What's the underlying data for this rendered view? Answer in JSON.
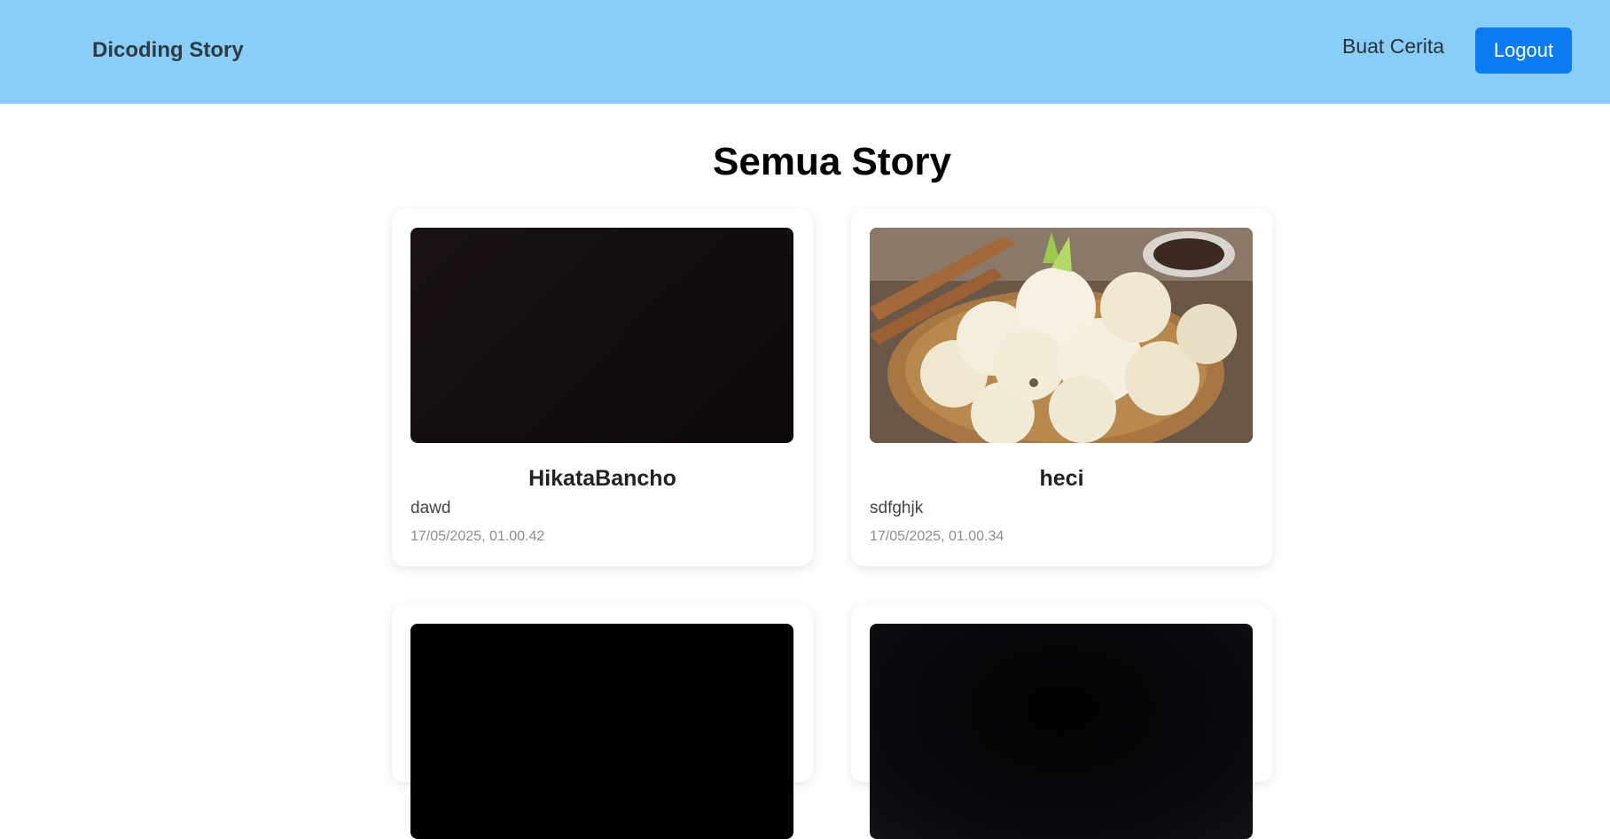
{
  "header": {
    "brand": "Dicoding Story",
    "nav_create": "Buat Cerita",
    "logout_label": "Logout"
  },
  "main": {
    "title": "Semua Story"
  },
  "stories": [
    {
      "name": "HikataBancho",
      "description": "dawd",
      "date": "17/05/2025, 01.00.42",
      "image": "dark-photo"
    },
    {
      "name": "heci",
      "description": "sdfghjk",
      "date": "17/05/2025, 01.00.34",
      "image": "fried-cireng-photo"
    },
    {
      "name": "",
      "description": "",
      "date": "",
      "image": "black-photo"
    },
    {
      "name": "",
      "description": "",
      "date": "",
      "image": "dark-photo"
    }
  ],
  "colors": {
    "header_bg": "#89cdf9",
    "logout_bg": "#0a7bf0"
  }
}
